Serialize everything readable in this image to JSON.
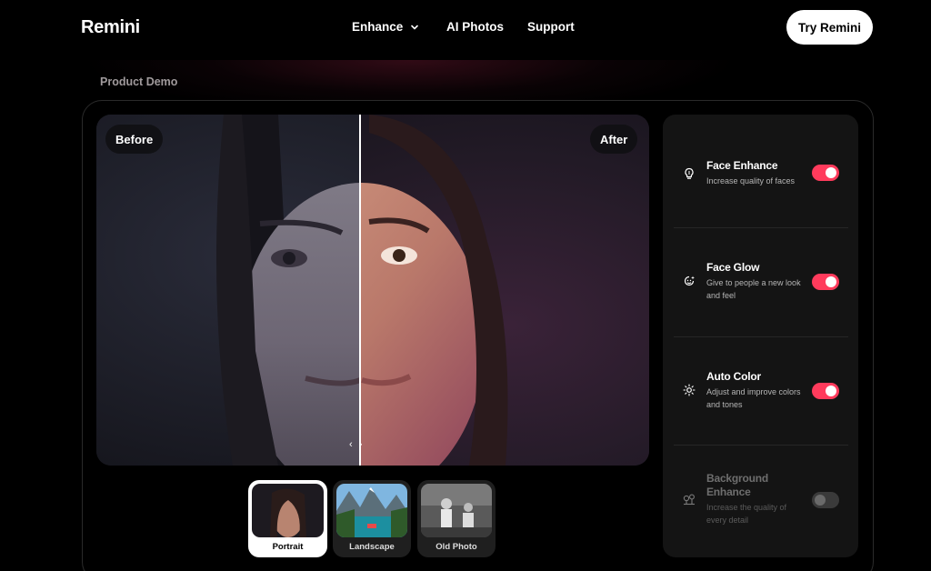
{
  "header": {
    "logo": "Remini",
    "nav": [
      {
        "label": "Enhance",
        "has_dropdown": true
      },
      {
        "label": "AI Photos"
      },
      {
        "label": "Support"
      }
    ],
    "cta_label": "Try Remini"
  },
  "demo": {
    "section_label": "Product Demo",
    "before_label": "Before",
    "after_label": "After",
    "handle_glyph": "‹ ›",
    "thumbnails": [
      {
        "label": "Portrait",
        "selected": true
      },
      {
        "label": "Landscape",
        "selected": false
      },
      {
        "label": "Old Photo",
        "selected": false
      }
    ]
  },
  "options": [
    {
      "title": "Face Enhance",
      "desc": "Increase quality of faces",
      "icon": "lightbulb-icon",
      "enabled": true
    },
    {
      "title": "Face Glow",
      "desc": "Give to people a new look and feel",
      "icon": "glow-icon",
      "enabled": true
    },
    {
      "title": "Auto Color",
      "desc": "Adjust and improve colors and tones",
      "icon": "sun-icon",
      "enabled": true
    },
    {
      "title": "Background Enhance",
      "desc": "Increase the quality of every detail",
      "icon": "trees-icon",
      "enabled": false
    }
  ],
  "colors": {
    "accent": "#ff3b5c",
    "panel": "#141414",
    "background": "#000000"
  }
}
